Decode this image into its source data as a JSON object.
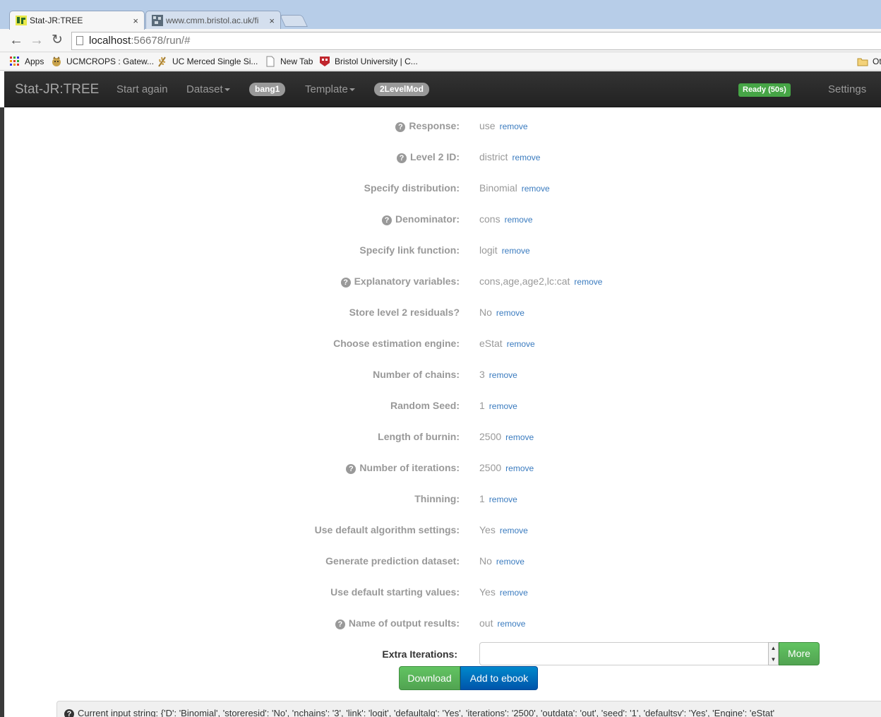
{
  "browser": {
    "tabs": [
      {
        "title": "Stat-JR:TREE",
        "close": "×"
      },
      {
        "title": "www.cmm.bristol.ac.uk/fi",
        "close": "×"
      }
    ],
    "url_host": "localhost",
    "url_rest": ":56678/run/#",
    "bookmarks": [
      {
        "label": "Apps",
        "icon": "apps-grid-icon"
      },
      {
        "label": "UCMCROPS : Gatew...",
        "icon": "bobcat-icon"
      },
      {
        "label": "UC Merced Single Si...",
        "icon": "wheat-icon"
      },
      {
        "label": "New Tab",
        "icon": "page-icon"
      },
      {
        "label": "Bristol University | C...",
        "icon": "crest-icon"
      },
      {
        "label": "Ot",
        "icon": "folder-icon"
      }
    ]
  },
  "navbar": {
    "brand": "Stat-JR:TREE",
    "start_again": "Start again",
    "dataset": "Dataset",
    "dataset_badge": "bang1",
    "template": "Template",
    "template_badge": "2LevelMod",
    "status": "Ready (50s)",
    "settings": "Settings"
  },
  "form": {
    "remove_label": "remove",
    "help_glyph": "?",
    "rows": [
      {
        "label": "Response:",
        "value": "use",
        "help": true
      },
      {
        "label": "Level 2 ID:",
        "value": "district",
        "help": true
      },
      {
        "label": "Specify distribution:",
        "value": "Binomial",
        "help": false
      },
      {
        "label": "Denominator:",
        "value": "cons",
        "help": true
      },
      {
        "label": "Specify link function:",
        "value": "logit",
        "help": false
      },
      {
        "label": "Explanatory variables:",
        "value": "cons,age,age2,lc:cat",
        "help": true
      },
      {
        "label": "Store level 2 residuals?",
        "value": "No",
        "help": false
      },
      {
        "label": "Choose estimation engine:",
        "value": "eStat",
        "help": false
      },
      {
        "label": "Number of chains:",
        "value": "3",
        "help": false
      },
      {
        "label": "Random Seed:",
        "value": "1",
        "help": false
      },
      {
        "label": "Length of burnin:",
        "value": "2500",
        "help": false
      },
      {
        "label": "Number of iterations:",
        "value": "2500",
        "help": true
      },
      {
        "label": "Thinning:",
        "value": "1",
        "help": false
      },
      {
        "label": "Use default algorithm settings:",
        "value": "Yes",
        "help": false
      },
      {
        "label": "Generate prediction dataset:",
        "value": "No",
        "help": false
      },
      {
        "label": "Use default starting values:",
        "value": "Yes",
        "help": false
      },
      {
        "label": "Name of output results:",
        "value": "out",
        "help": true
      }
    ],
    "extra_iterations_label": "Extra Iterations:",
    "extra_iterations_value": "",
    "more_button": "More",
    "download_button": "Download",
    "ebook_button": "Add to ebook"
  },
  "input_string": "Current input string: {'D': 'Binomial', 'storeresid': 'No', 'nchains': '3', 'link': 'logit', 'defaultalg': 'Yes', 'iterations': '2500', 'outdata': 'out', 'seed': '1', 'defaultsv': 'Yes', 'Engine': 'eStat'"
}
